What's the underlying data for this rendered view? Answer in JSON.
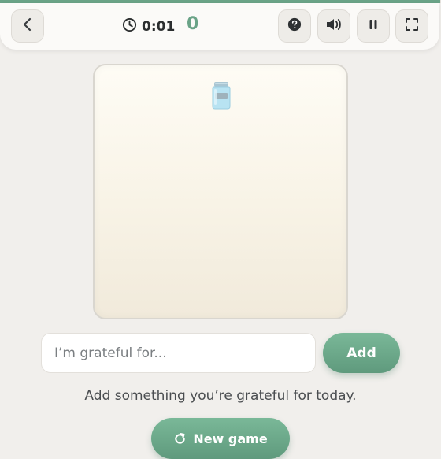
{
  "game": {
    "progress_fraction": 0.999,
    "timer": "0:01",
    "score": "0"
  },
  "icons": {
    "back": "chevron-left-icon",
    "clock": "clock-icon",
    "help": "question-icon",
    "sound": "speaker-icon",
    "pause": "pause-icon",
    "fullscreen": "fullscreen-icon",
    "jar": "jar-icon",
    "restart": "restart-icon"
  },
  "entry": {
    "placeholder": "I’m grateful for...",
    "value": "",
    "add_label": "Add"
  },
  "hint": "Add something you’re grateful for today.",
  "new_game_label": "New game",
  "colors": {
    "accent": "#6aa387",
    "background": "#f1efec",
    "board_top": "#fefcf5",
    "board_bottom": "#f1eadb"
  }
}
